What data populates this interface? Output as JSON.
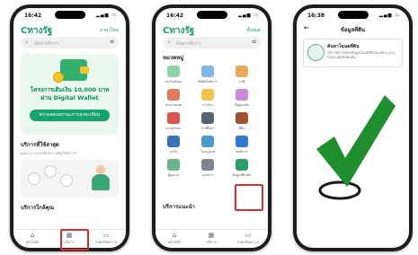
{
  "phone1": {
    "time": "16:42",
    "logo": "Cทางรัฐ",
    "lang": "ภาษาไทย",
    "search_placeholder": "ค้นหาบริการ",
    "banner_title_1": "โครงการเติมเงิน 10,000 บาท",
    "banner_title_2": "ผ่าน Digital Wallet",
    "banner_button": "ตรวจสอบสถานะการลงทะเบียน",
    "section1": "บริการที่ใช้ล่าสุด",
    "section1_sub": "คุณสามารถกดที่บริการเพื่อใช้บริการ",
    "section2": "บริการใกล้คุณ",
    "nav": [
      "หน้าหลัก",
      "บริการ",
      "กล่องข้อความ"
    ]
  },
  "phone2": {
    "time": "16:42",
    "logo": "Cทางรัฐ",
    "lang": "ทั้งหมด",
    "search_placeholder": "ค้นหาบริการ",
    "section1": "หมวดหมู่",
    "categories": [
      "ประกันสังคม",
      "สิทธิสวัสดิการ",
      "ภาษี",
      "สาธารณสุข",
      "การเงิน",
      "ที่อยู่อาศัย",
      "ยานพาหนะ",
      "การศึกษา",
      "ที่ดิน",
      "ธุรกิจ",
      "ใบอนุญาต",
      "คนพิการ",
      "ผู้สูงอายุ",
      "เอกสาร",
      "ข้อมูลเพิ่มเติม"
    ],
    "section2": "บริการแนะนำ",
    "nav": [
      "หน้าหลัก",
      "บริการ",
      "กล่องข้อความ"
    ]
  },
  "phone3": {
    "time": "16:38",
    "title": "ข้อมูลที่ดิน",
    "service_title": "ค้นหาโฉนดที่ดิน",
    "service_desc": "บริการตรวจสอบข้อมูลโฉนดที่ดินของท่าน และรายละเอียดเพิ่มเติม"
  },
  "colors": {
    "brand": "#16a46c",
    "highlight": "#e52b2b",
    "check": "#1f8f2e"
  }
}
